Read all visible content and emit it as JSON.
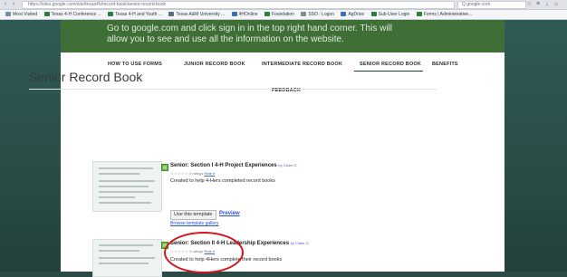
{
  "browser": {
    "address": "https://sites.google.com/site/texas4h/record-book/senior-record-book",
    "search_placeholder": "Q google.com",
    "bookmarks": [
      {
        "label": "Most Visited",
        "color": "#7a8fa6"
      },
      {
        "label": "Texas 4-H Conference ...",
        "color": "#2f7d3a"
      },
      {
        "label": "Texas 4-H and Youth ...",
        "color": "#2f7d3a"
      },
      {
        "label": "Texas A&M University ...",
        "color": "#5b6b7d"
      },
      {
        "label": "4HOnline",
        "color": "#3c6fb6"
      },
      {
        "label": "Foundation",
        "color": "#2f7d3a"
      },
      {
        "label": "SSO : Logon",
        "color": "#888888"
      },
      {
        "label": "AgDrive",
        "color": "#3c6fb6"
      },
      {
        "label": "Sub-User Login",
        "color": "#2f7d3a"
      },
      {
        "label": "Forms | Administrative...",
        "color": "#2f7d3a"
      }
    ]
  },
  "banner": {
    "text": "Go to google.com and click sign in in the top right hand corner. This will allow you to see and use all the information on the website."
  },
  "nav": {
    "items": [
      "HOW TO USE FORMS",
      "JUNIOR RECORD BOOK",
      "INTERMEDIATE RECORD BOOK",
      "SENIOR RECORD BOOK",
      "BENEFITS"
    ],
    "second_row": "FEEDBACK",
    "active_index": 3
  },
  "page": {
    "title": "Senior Record Book"
  },
  "templates": [
    {
      "title": "Senior: Section I 4-H Project Experiences",
      "author": "by Claire G.",
      "stars": "☆☆☆☆☆",
      "ratings": "0 ratings",
      "rate_link": "Rate it",
      "description": "Created to help 4-Hers completed record books",
      "use_button": "Use this template",
      "preview": "Preview",
      "gallery": "Browse template gallery"
    },
    {
      "title": "Senior: Section II 4-H Leadership Experiences",
      "author": "by Claire G.",
      "stars": "☆☆☆☆☆",
      "ratings": "0 ratings",
      "rate_link": "Rate it",
      "description": "Created to help 4Hers complete their record books"
    }
  ],
  "colors": {
    "banner": "#3f6f37",
    "link": "#2b4fd6",
    "annotation": "#d6141b"
  }
}
